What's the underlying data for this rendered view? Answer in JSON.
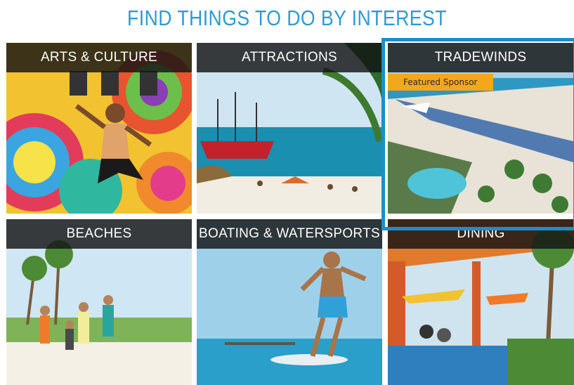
{
  "header": {
    "title": "FIND THINGS TO DO BY INTEREST"
  },
  "tiles": [
    {
      "label": "ARTS & CULTURE"
    },
    {
      "label": "ATTRACTIONS"
    },
    {
      "label": "TRADEWINDS",
      "badge": "Featured Sponsor"
    },
    {
      "label": "BEACHES"
    },
    {
      "label": "BOATING & WATERSPORTS"
    },
    {
      "label": "DINING"
    }
  ],
  "colors": {
    "accent": "#2d9bd2",
    "frame": "#1d8fc7",
    "badge": "#f3a81c"
  }
}
